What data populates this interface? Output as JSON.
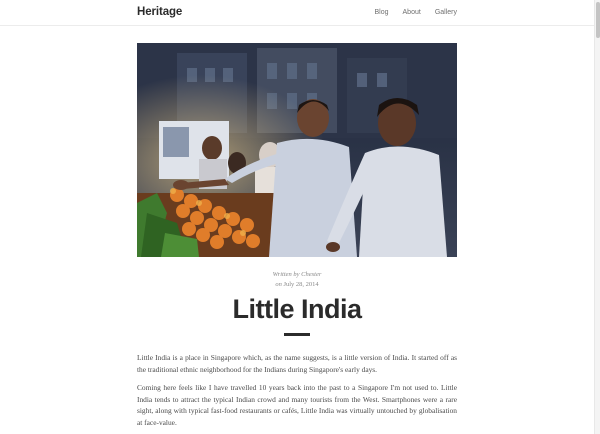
{
  "header": {
    "brand": "Heritage",
    "nav": [
      {
        "label": "Blog"
      },
      {
        "label": "About"
      },
      {
        "label": "Gallery"
      }
    ]
  },
  "hero": {
    "image_icon": "photo-market-vendors"
  },
  "post": {
    "byline": "Written by Chester",
    "on": "on",
    "date": "July 28, 2014",
    "title": "Little India",
    "paragraphs": [
      "Little India is a place in Singapore which, as the name suggests, is a little version of India. It started off as the traditional ethnic neighborhood for the Indians during Singapore's early days.",
      "Coming here feels like I have travelled 10 years back into the past to a Singapore I'm not used to. Little India tends to attract the typical Indian crowd and many tourists from the West. Smartphones were a rare sight, along with typical fast-food restaurants or cafés, Little India was virtually untouched by globalisation at face-value."
    ]
  },
  "colors": {
    "text": "#2b2b2b",
    "muted": "#8a8a8a",
    "body": "#4a4a4a",
    "background": "#ffffff"
  }
}
